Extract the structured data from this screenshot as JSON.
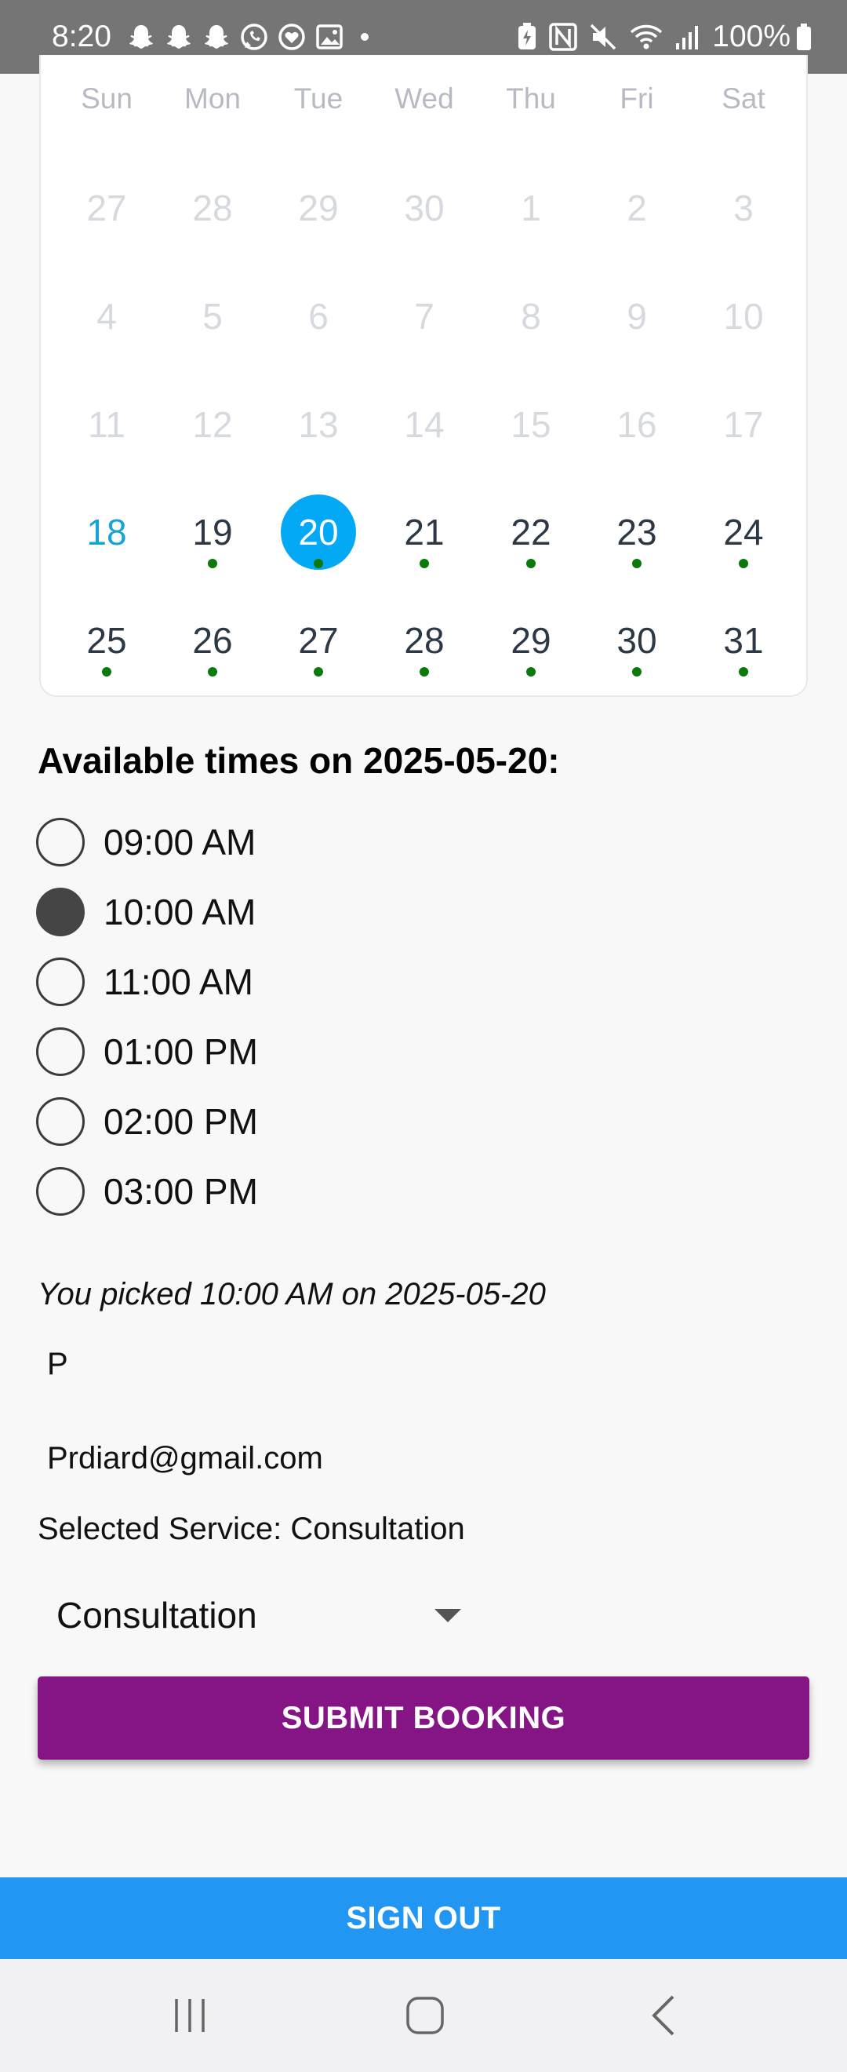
{
  "status_bar": {
    "time": "8:20",
    "battery": "100%",
    "left_icons": [
      "snapchat-icon",
      "snapchat-icon",
      "snapchat-icon",
      "whatsapp-icon",
      "messenger-heart-icon",
      "gallery-icon",
      "dot-icon"
    ],
    "right_icons": [
      "battery-saver-icon",
      "nfc-icon",
      "mute-icon",
      "wifi-icon",
      "signal-icon",
      "battery-icon"
    ]
  },
  "calendar": {
    "weekdays": [
      "Sun",
      "Mon",
      "Tue",
      "Wed",
      "Thu",
      "Fri",
      "Sat"
    ],
    "weeks": [
      [
        "27",
        "28",
        "29",
        "30",
        "1",
        "2",
        "3"
      ],
      [
        "4",
        "5",
        "6",
        "7",
        "8",
        "9",
        "10"
      ],
      [
        "11",
        "12",
        "13",
        "14",
        "15",
        "16",
        "17"
      ],
      [
        "18",
        "19",
        "20",
        "21",
        "22",
        "23",
        "24"
      ],
      [
        "25",
        "26",
        "27",
        "28",
        "29",
        "30",
        "31"
      ]
    ],
    "disabled_weeks": [
      0,
      1,
      2
    ],
    "today": "18",
    "selected": "20",
    "available_days": [
      "19",
      "20",
      "21",
      "22",
      "23",
      "24",
      "25",
      "26",
      "27",
      "28",
      "29",
      "30",
      "31"
    ],
    "colors": {
      "selected": "#03a9f4",
      "today": "#17a2d8",
      "available_dot": "#0a7a0a",
      "disabled": "#d6d9de",
      "enabled": "#2d3845"
    }
  },
  "times": {
    "heading": "Available times on 2025-05-20:",
    "slots": [
      {
        "label": "09:00 AM",
        "checked": false
      },
      {
        "label": "10:00 AM",
        "checked": true
      },
      {
        "label": "11:00 AM",
        "checked": false
      },
      {
        "label": "01:00 PM",
        "checked": false
      },
      {
        "label": "02:00 PM",
        "checked": false
      },
      {
        "label": "03:00 PM",
        "checked": false
      }
    ]
  },
  "booking": {
    "picked_text": "You picked 10:00 AM on 2025-05-20",
    "name": "P",
    "email": "Prdiard@gmail.com",
    "service_label": "Selected Service: Consultation",
    "service_value": "Consultation",
    "submit_label": "SUBMIT BOOKING",
    "signout_label": "SIGN OUT"
  },
  "colors": {
    "submit": "#851585",
    "signout": "#2196f3",
    "status_bar": "#757575"
  },
  "nav_bar": [
    "recents-icon",
    "home-icon",
    "back-icon"
  ]
}
